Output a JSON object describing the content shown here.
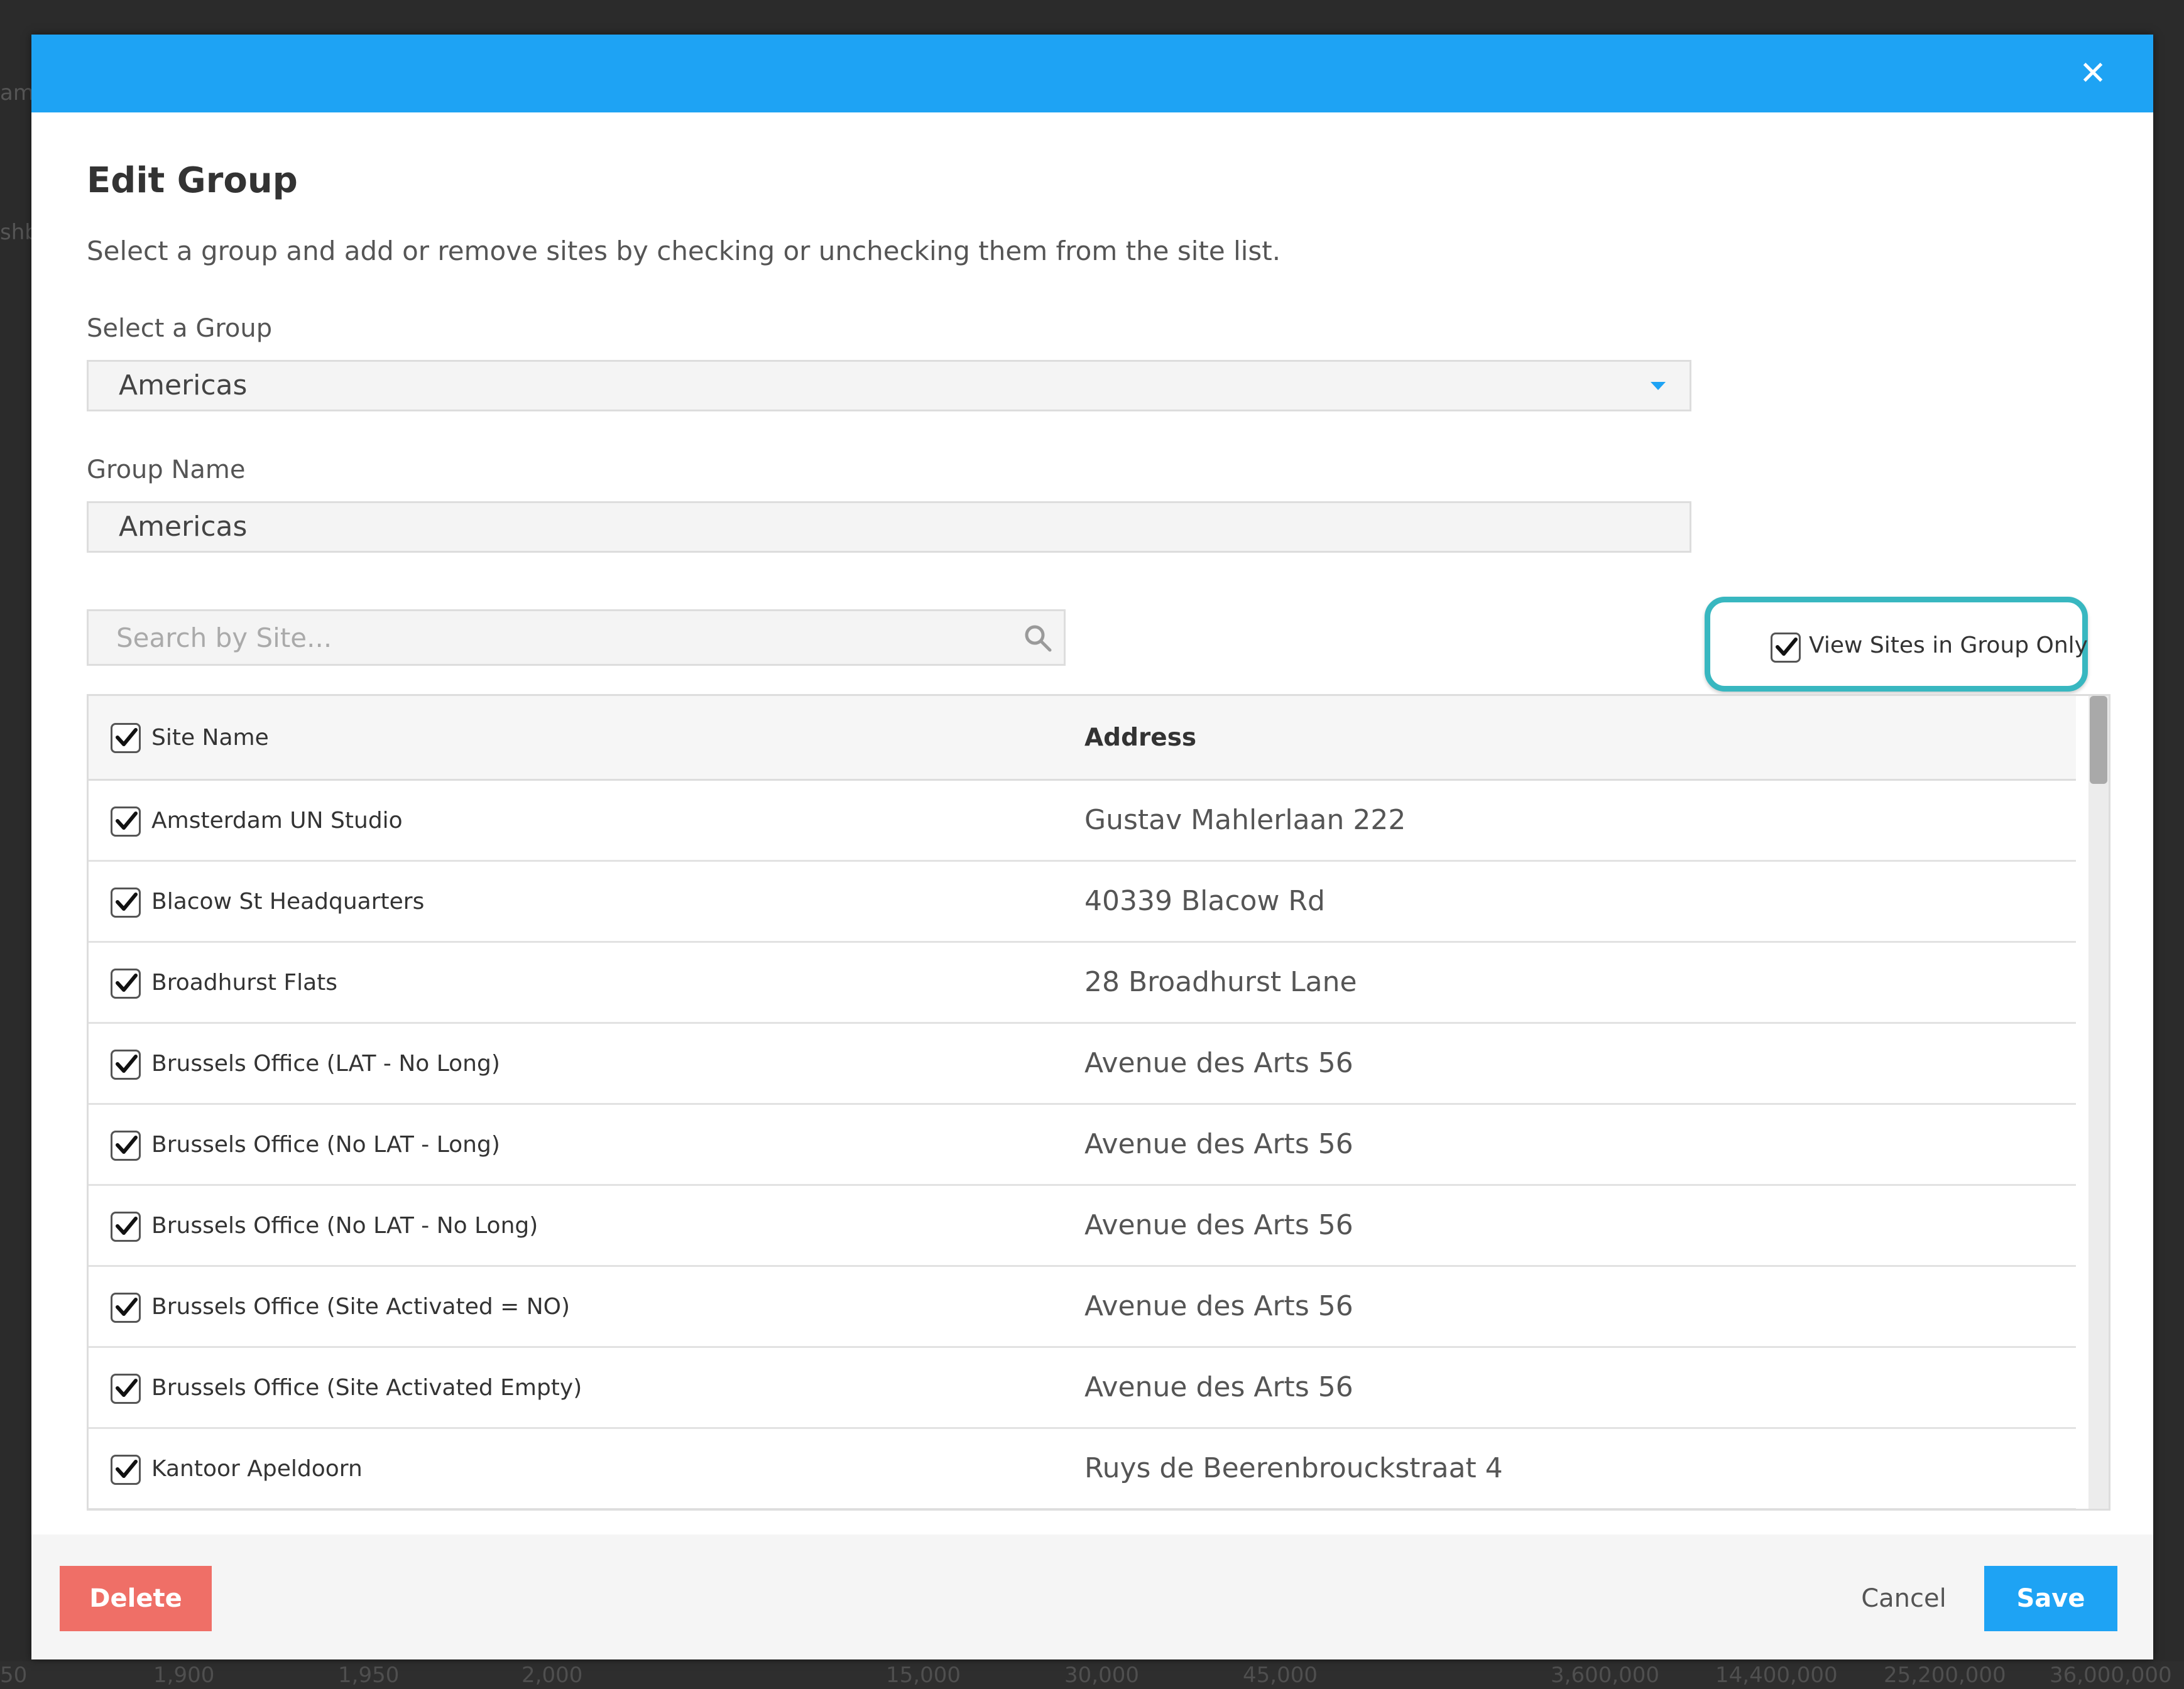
{
  "backdrop": {
    "left_fragments": [
      "am",
      "shb"
    ],
    "axis_labels": [
      "50",
      "1,900",
      "1,950",
      "2,000",
      "15,000",
      "30,000",
      "45,000",
      "3,600,000",
      "14,400,000",
      "25,200,000",
      "36,000,000"
    ]
  },
  "modal": {
    "close_icon": "close-icon",
    "title": "Edit Group",
    "subtitle": "Select a group and add or remove sites by checking or unchecking them from the site list.",
    "select_group": {
      "label": "Select a Group",
      "value": "Americas"
    },
    "group_name": {
      "label": "Group Name",
      "value": "Americas"
    },
    "search": {
      "placeholder": "Search by Site...",
      "value": ""
    },
    "view_sites_in_group_only": {
      "label": "View Sites in Group Only",
      "checked": true
    },
    "accent_color": "#1ea3f4",
    "highlight_color": "#38b7c0",
    "delete_color": "#ef6f67"
  },
  "table": {
    "columns": {
      "site_name": "Site Name",
      "address": "Address"
    },
    "header_checked": true,
    "rows": [
      {
        "site": "Amsterdam UN Studio",
        "address": "Gustav Mahlerlaan 222",
        "checked": true
      },
      {
        "site": "Blacow St Headquarters",
        "address": "40339 Blacow Rd",
        "checked": true
      },
      {
        "site": "Broadhurst Flats",
        "address": "28 Broadhurst Lane",
        "checked": true
      },
      {
        "site": "Brussels Office (LAT - No Long)",
        "address": "Avenue des Arts 56",
        "checked": true
      },
      {
        "site": "Brussels Office (No LAT - Long)",
        "address": "Avenue des Arts 56",
        "checked": true
      },
      {
        "site": "Brussels Office (No LAT - No Long)",
        "address": "Avenue des Arts 56",
        "checked": true
      },
      {
        "site": "Brussels Office (Site Activated = NO)",
        "address": "Avenue des Arts 56",
        "checked": true
      },
      {
        "site": "Brussels Office (Site Activated Empty)",
        "address": "Avenue des Arts 56",
        "checked": true
      },
      {
        "site": "Kantoor Apeldoorn",
        "address": "Ruys de Beerenbrouckstraat 4",
        "checked": true
      }
    ]
  },
  "footer": {
    "delete_label": "Delete",
    "cancel_label": "Cancel",
    "save_label": "Save"
  }
}
